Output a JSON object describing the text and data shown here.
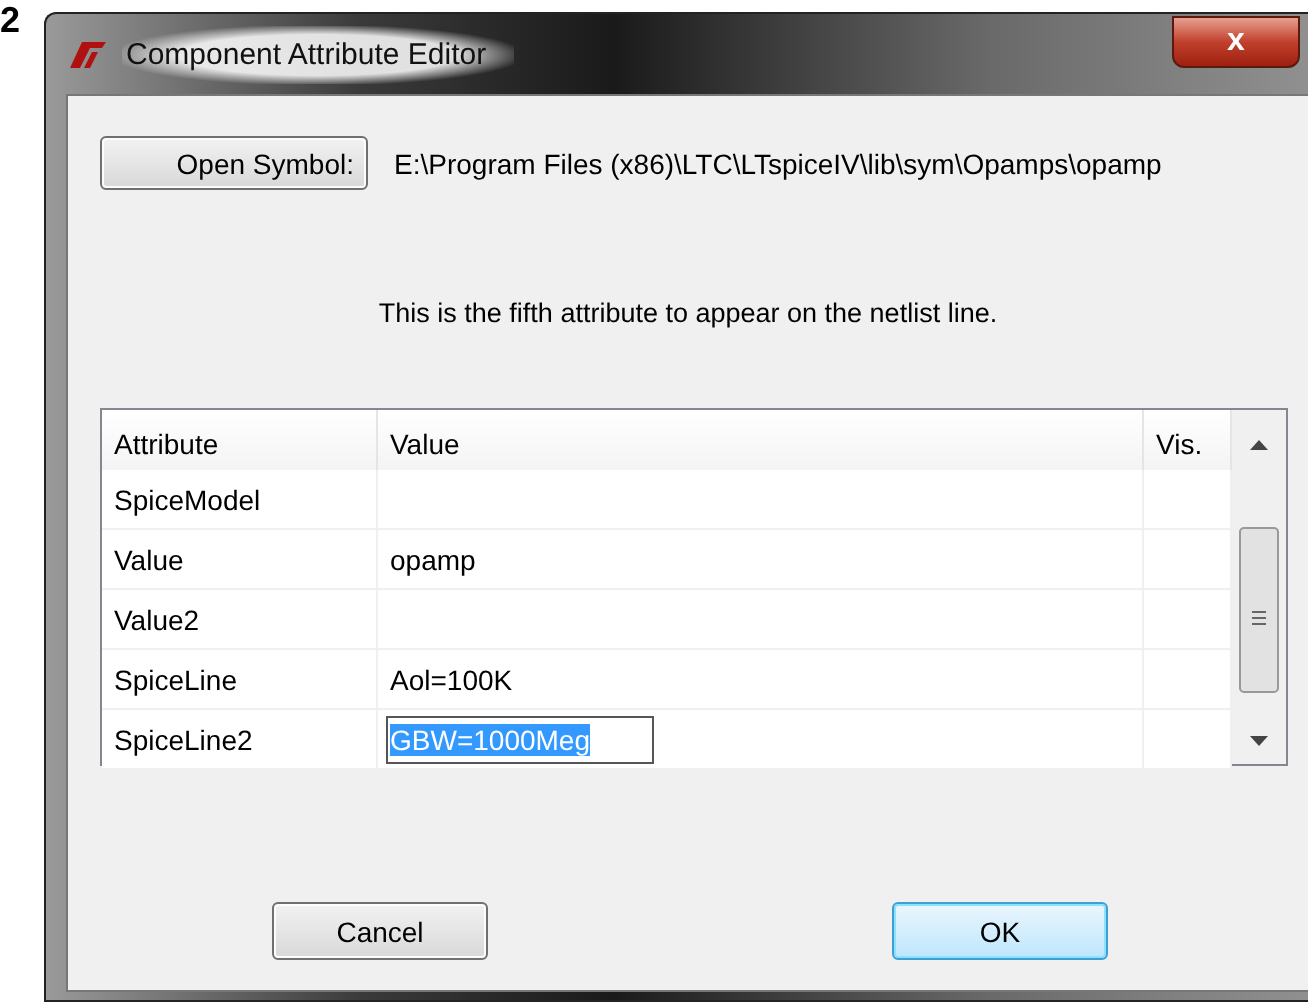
{
  "page_number": "2",
  "window": {
    "title": "Component Attribute Editor",
    "close": "x"
  },
  "open_symbol": {
    "button": "Open Symbol:",
    "path": "E:\\Program Files (x86)\\LTC\\LTspiceIV\\lib\\sym\\Opamps\\opamp"
  },
  "description": "This is the fifth attribute to appear on the netlist line.",
  "table": {
    "columns": [
      "Attribute",
      "Value",
      "Vis."
    ],
    "rows": [
      {
        "attribute": "SpiceModel",
        "value": "",
        "editing": false
      },
      {
        "attribute": "Value",
        "value": "opamp",
        "editing": false
      },
      {
        "attribute": "Value2",
        "value": "",
        "editing": false
      },
      {
        "attribute": "SpiceLine",
        "value": "Aol=100K",
        "editing": false
      },
      {
        "attribute": "SpiceLine2",
        "value": "GBW=1000Meg",
        "editing": true
      }
    ]
  },
  "buttons": [
    {
      "label": "Cancel",
      "kind": "normal"
    },
    {
      "label": "OK",
      "kind": "default"
    }
  ]
}
